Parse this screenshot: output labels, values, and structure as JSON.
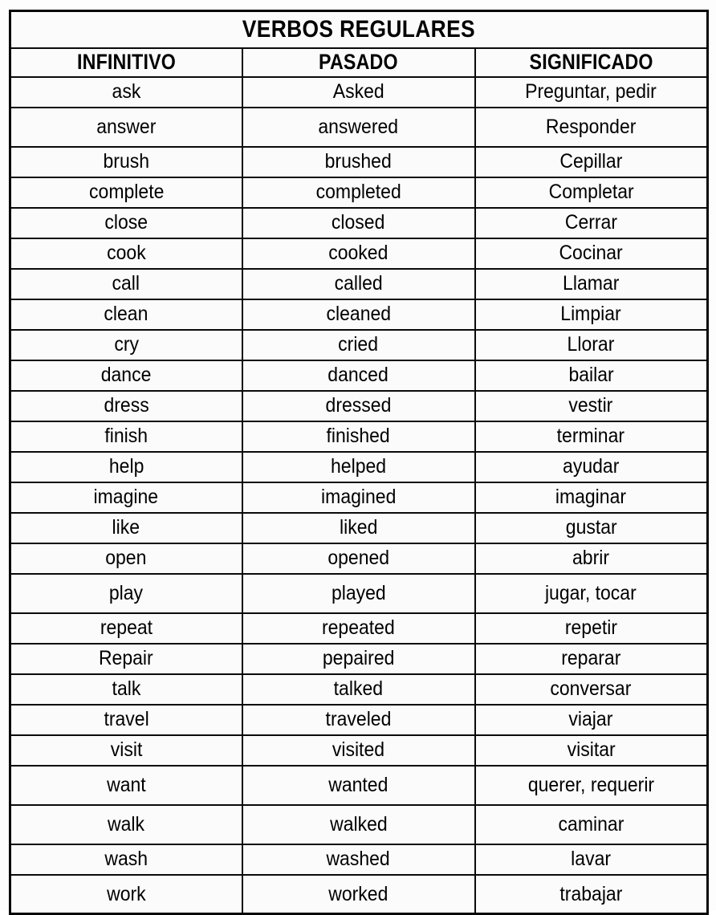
{
  "table": {
    "title": "VERBOS REGULARES",
    "columns": [
      "INFINITIVO",
      "PASADO",
      "SIGNIFICADO"
    ],
    "rows": [
      {
        "infinitivo": "ask",
        "pasado": "Asked",
        "significado": "Preguntar, pedir",
        "tall": false
      },
      {
        "infinitivo": "answer",
        "pasado": "answered",
        "significado": "Responder",
        "tall": true
      },
      {
        "infinitivo": "brush",
        "pasado": "brushed",
        "significado": "Cepillar",
        "tall": false
      },
      {
        "infinitivo": "complete",
        "pasado": "completed",
        "significado": "Completar",
        "tall": false
      },
      {
        "infinitivo": "close",
        "pasado": "closed",
        "significado": "Cerrar",
        "tall": false
      },
      {
        "infinitivo": "cook",
        "pasado": "cooked",
        "significado": "Cocinar",
        "tall": false
      },
      {
        "infinitivo": "call",
        "pasado": "called",
        "significado": "Llamar",
        "tall": false
      },
      {
        "infinitivo": "clean",
        "pasado": "cleaned",
        "significado": "Limpiar",
        "tall": false
      },
      {
        "infinitivo": "cry",
        "pasado": "cried",
        "significado": "Llorar",
        "tall": false
      },
      {
        "infinitivo": "dance",
        "pasado": "danced",
        "significado": "bailar",
        "tall": false
      },
      {
        "infinitivo": "dress",
        "pasado": "dressed",
        "significado": "vestir",
        "tall": false
      },
      {
        "infinitivo": "finish",
        "pasado": "finished",
        "significado": "terminar",
        "tall": false
      },
      {
        "infinitivo": "help",
        "pasado": "helped",
        "significado": "ayudar",
        "tall": false
      },
      {
        "infinitivo": "imagine",
        "pasado": "imagined",
        "significado": "imaginar",
        "tall": false
      },
      {
        "infinitivo": "like",
        "pasado": "liked",
        "significado": "gustar",
        "tall": false
      },
      {
        "infinitivo": "open",
        "pasado": "opened",
        "significado": "abrir",
        "tall": false
      },
      {
        "infinitivo": "play",
        "pasado": "played",
        "significado": "jugar, tocar",
        "tall": true
      },
      {
        "infinitivo": "repeat",
        "pasado": "repeated",
        "significado": "repetir",
        "tall": false
      },
      {
        "infinitivo": "Repair",
        "pasado": "pepaired",
        "significado": "reparar",
        "tall": false
      },
      {
        "infinitivo": "talk",
        "pasado": "talked",
        "significado": "conversar",
        "tall": false
      },
      {
        "infinitivo": "travel",
        "pasado": "traveled",
        "significado": "viajar",
        "tall": false
      },
      {
        "infinitivo": "visit",
        "pasado": "visited",
        "significado": "visitar",
        "tall": false
      },
      {
        "infinitivo": "want",
        "pasado": "wanted",
        "significado": "querer, requerir",
        "tall": true
      },
      {
        "infinitivo": "walk",
        "pasado": "walked",
        "significado": "caminar",
        "tall": true
      },
      {
        "infinitivo": "wash",
        "pasado": "washed",
        "significado": "lavar",
        "tall": false
      },
      {
        "infinitivo": "work",
        "pasado": "worked",
        "significado": "trabajar",
        "tall": true
      }
    ]
  },
  "colors": {
    "border": "#0a0a0a",
    "text": "#000000",
    "cell_background": "#fbfbfb",
    "page_background": "#fdfdfd"
  }
}
